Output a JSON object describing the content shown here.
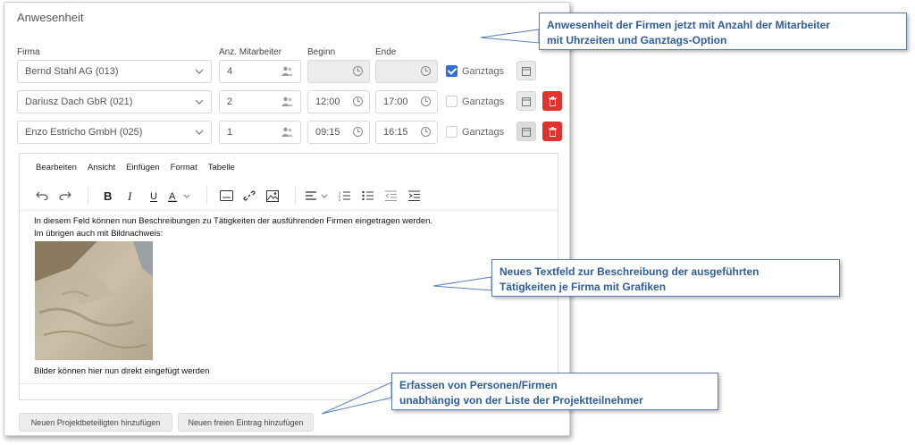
{
  "section": {
    "title": "Anwesenheit"
  },
  "columns": {
    "firma": "Firma",
    "mitarbeiter": "Anz. Mitarbeiter",
    "beginn": "Beginn",
    "ende": "Ende"
  },
  "rows": [
    {
      "firma": "Bernd Stahl AG (013)",
      "count": "4",
      "beginn": "",
      "ende": "",
      "ganztags": true,
      "ganztags_label": "Ganztags"
    },
    {
      "firma": "Dariusz Dach GbR (021)",
      "count": "2",
      "beginn": "12:00",
      "ende": "17:00",
      "ganztags": false,
      "ganztags_label": "Ganztags"
    },
    {
      "firma": "Enzo Estricho GmbH (025)",
      "count": "1",
      "beginn": "09:15",
      "ende": "16:15",
      "ganztags": false,
      "ganztags_label": "Ganztags"
    }
  ],
  "editor": {
    "menu": [
      "Bearbeiten",
      "Ansicht",
      "Einfügen",
      "Format",
      "Tabelle"
    ],
    "line1": "In diesem Feld können nun Beschreibungen zu Tätigkeiten der ausführenden Firmen eingetragen werden.",
    "line2": "Im übrigen auch mit Bildnachweis:",
    "line3": "Bilder können hier nun direkt eingefügt werden"
  },
  "buttons": {
    "add_participant": "Neuen Projektbeteiligten hinzufügen",
    "add_free": "Neuen freien Eintrag hinzufügen"
  },
  "callouts": {
    "c1": [
      "Anwesenheit der Firmen jetzt mit Anzahl der Mitarbeiter",
      "mit Uhrzeiten und Ganztags-Option"
    ],
    "c2": [
      "Neues Textfeld zur Beschreibung der ausgeführten",
      "Tätigkeiten je Firma mit Grafiken"
    ],
    "c3": [
      "Erfassen von Personen/Firmen",
      "unabhängig von der Liste der Projektteilnehmer"
    ]
  },
  "colors": {
    "accent": "#2f6fd1",
    "danger": "#e0332e",
    "callout_text": "#2f5d9c",
    "callout_border": "#5b7fb8"
  }
}
